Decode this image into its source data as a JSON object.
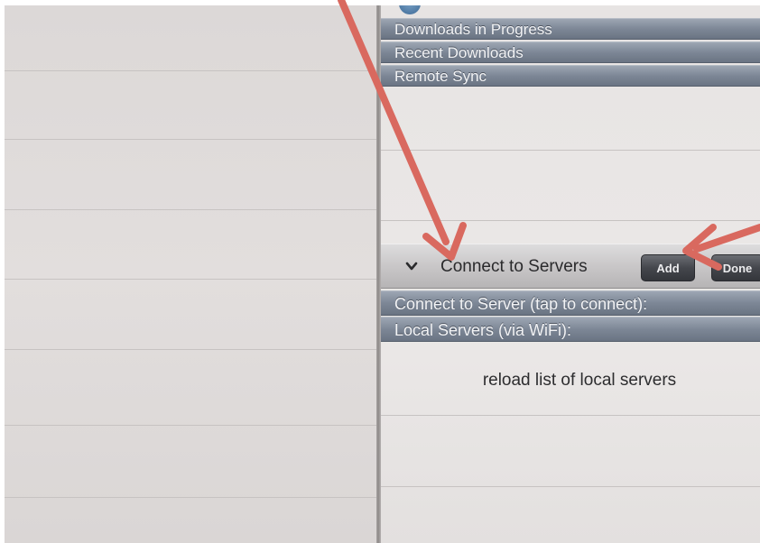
{
  "right_pane": {
    "sections_top": [
      {
        "label": "Downloads in Progress"
      },
      {
        "label": "Recent Downloads"
      },
      {
        "label": "Remote Sync"
      }
    ],
    "toolbar": {
      "title": "Connect to Servers",
      "add_label": "Add",
      "done_label": "Done"
    },
    "sections_bottom": [
      {
        "label": "Connect to Server (tap to connect):"
      },
      {
        "label": "Local Servers (via WiFi):"
      }
    ],
    "reload_label": "reload list of local servers"
  },
  "icons": {
    "toolbar_chevron": "chevron-down-icon",
    "partial_logo": "app-logo-icon"
  },
  "colors": {
    "annotation_arrow": "#d9695f",
    "section_header": "#7d8796",
    "toolbar_button": "#45474d"
  }
}
